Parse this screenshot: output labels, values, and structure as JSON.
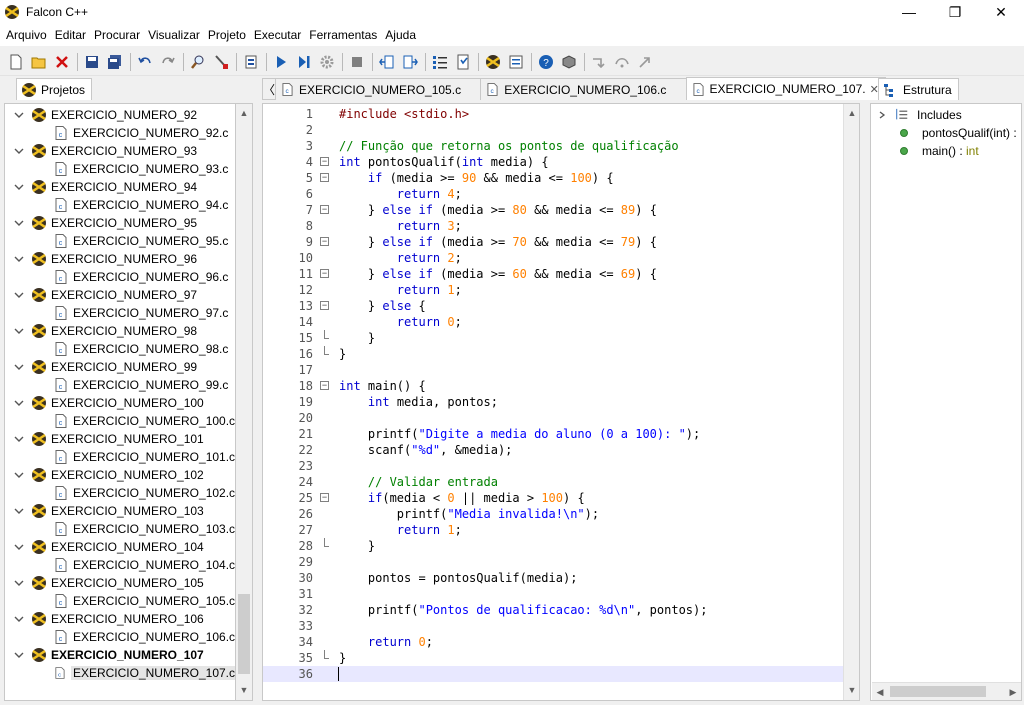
{
  "window": {
    "title": "Falcon C++",
    "minimize_label": "—",
    "maximize_label": "❐",
    "close_label": "✕"
  },
  "menu": [
    "Arquivo",
    "Editar",
    "Procurar",
    "Visualizar",
    "Projeto",
    "Executar",
    "Ferramentas",
    "Ajuda"
  ],
  "toolbar": {
    "icons": [
      "new-file-icon",
      "open-folder-icon",
      "close-file-icon",
      "save-icon",
      "save-all-icon",
      "undo-icon",
      "redo-icon",
      "find-icon",
      "replace-icon",
      "compile-icon",
      "run-icon",
      "step-icon",
      "debug-gear-icon",
      "stop-icon",
      "indent-icon",
      "unindent-icon",
      "list-icon",
      "bookmark-icon",
      "falcon-icon",
      "settings-icon",
      "help-icon",
      "packages-icon",
      "step-into-icon",
      "step-over-icon",
      "step-out-icon"
    ]
  },
  "projects_panel": {
    "tab_label": "Projetos",
    "projects": [
      {
        "name": "EXERCICIO_NUMERO_92",
        "file": "EXERCICIO_NUMERO_92.c"
      },
      {
        "name": "EXERCICIO_NUMERO_93",
        "file": "EXERCICIO_NUMERO_93.c"
      },
      {
        "name": "EXERCICIO_NUMERO_94",
        "file": "EXERCICIO_NUMERO_94.c"
      },
      {
        "name": "EXERCICIO_NUMERO_95",
        "file": "EXERCICIO_NUMERO_95.c"
      },
      {
        "name": "EXERCICIO_NUMERO_96",
        "file": "EXERCICIO_NUMERO_96.c"
      },
      {
        "name": "EXERCICIO_NUMERO_97",
        "file": "EXERCICIO_NUMERO_97.c"
      },
      {
        "name": "EXERCICIO_NUMERO_98",
        "file": "EXERCICIO_NUMERO_98.c"
      },
      {
        "name": "EXERCICIO_NUMERO_99",
        "file": "EXERCICIO_NUMERO_99.c"
      },
      {
        "name": "EXERCICIO_NUMERO_100",
        "file": "EXERCICIO_NUMERO_100.c"
      },
      {
        "name": "EXERCICIO_NUMERO_101",
        "file": "EXERCICIO_NUMERO_101.c"
      },
      {
        "name": "EXERCICIO_NUMERO_102",
        "file": "EXERCICIO_NUMERO_102.c"
      },
      {
        "name": "EXERCICIO_NUMERO_103",
        "file": "EXERCICIO_NUMERO_103.c"
      },
      {
        "name": "EXERCICIO_NUMERO_104",
        "file": "EXERCICIO_NUMERO_104.c"
      },
      {
        "name": "EXERCICIO_NUMERO_105",
        "file": "EXERCICIO_NUMERO_105.c"
      },
      {
        "name": "EXERCICIO_NUMERO_106",
        "file": "EXERCICIO_NUMERO_106.c"
      },
      {
        "name": "EXERCICIO_NUMERO_107",
        "file": "EXERCICIO_NUMERO_107.c",
        "active": true
      }
    ]
  },
  "editor": {
    "tab_nav_label": "〈",
    "tabs": [
      {
        "label": "EXERCICIO_NUMERO_105.c",
        "close": "✕",
        "active": false
      },
      {
        "label": "EXERCICIO_NUMERO_106.c",
        "close": "✕",
        "active": false
      },
      {
        "label": "EXERCICIO_NUMERO_107.",
        "close": "✕",
        "active": true
      }
    ],
    "current_line": 36,
    "lines": [
      {
        "n": "1",
        "fold": "",
        "tokens": [
          [
            "pp",
            "#include <stdio.h>"
          ]
        ]
      },
      {
        "n": "2",
        "fold": "",
        "tokens": []
      },
      {
        "n": "3",
        "fold": "",
        "tokens": [
          [
            "cmt",
            "// Função que retorna os pontos de qualificação"
          ]
        ]
      },
      {
        "n": "4",
        "fold": "open",
        "tokens": [
          [
            "kw",
            "int"
          ],
          [
            "",
            " pontosQualif("
          ],
          [
            "kw",
            "int"
          ],
          [
            "",
            " media) {"
          ]
        ]
      },
      {
        "n": "5",
        "fold": "open",
        "tokens": [
          [
            "",
            "    "
          ],
          [
            "kw",
            "if"
          ],
          [
            "",
            " (media >= "
          ],
          [
            "num",
            "90"
          ],
          [
            "",
            " && media <= "
          ],
          [
            "num",
            "100"
          ],
          [
            "",
            ") {"
          ]
        ]
      },
      {
        "n": "6",
        "fold": "",
        "tokens": [
          [
            "",
            "        "
          ],
          [
            "kw",
            "return"
          ],
          [
            "",
            " "
          ],
          [
            "num",
            "4"
          ],
          [
            "",
            ";"
          ]
        ]
      },
      {
        "n": "7",
        "fold": "open",
        "tokens": [
          [
            "",
            "    } "
          ],
          [
            "kw",
            "else if"
          ],
          [
            "",
            " (media >= "
          ],
          [
            "num",
            "80"
          ],
          [
            "",
            " && media <= "
          ],
          [
            "num",
            "89"
          ],
          [
            "",
            ") {"
          ]
        ]
      },
      {
        "n": "8",
        "fold": "",
        "tokens": [
          [
            "",
            "        "
          ],
          [
            "kw",
            "return"
          ],
          [
            "",
            " "
          ],
          [
            "num",
            "3"
          ],
          [
            "",
            ";"
          ]
        ]
      },
      {
        "n": "9",
        "fold": "open",
        "tokens": [
          [
            "",
            "    } "
          ],
          [
            "kw",
            "else if"
          ],
          [
            "",
            " (media >= "
          ],
          [
            "num",
            "70"
          ],
          [
            "",
            " && media <= "
          ],
          [
            "num",
            "79"
          ],
          [
            "",
            ") {"
          ]
        ]
      },
      {
        "n": "10",
        "fold": "",
        "tokens": [
          [
            "",
            "        "
          ],
          [
            "kw",
            "return"
          ],
          [
            "",
            " "
          ],
          [
            "num",
            "2"
          ],
          [
            "",
            ";"
          ]
        ]
      },
      {
        "n": "11",
        "fold": "open",
        "tokens": [
          [
            "",
            "    } "
          ],
          [
            "kw",
            "else if"
          ],
          [
            "",
            " (media >= "
          ],
          [
            "num",
            "60"
          ],
          [
            "",
            " && media <= "
          ],
          [
            "num",
            "69"
          ],
          [
            "",
            ") {"
          ]
        ]
      },
      {
        "n": "12",
        "fold": "",
        "tokens": [
          [
            "",
            "        "
          ],
          [
            "kw",
            "return"
          ],
          [
            "",
            " "
          ],
          [
            "num",
            "1"
          ],
          [
            "",
            ";"
          ]
        ]
      },
      {
        "n": "13",
        "fold": "open",
        "tokens": [
          [
            "",
            "    } "
          ],
          [
            "kw",
            "else"
          ],
          [
            "",
            " {"
          ]
        ]
      },
      {
        "n": "14",
        "fold": "",
        "tokens": [
          [
            "",
            "        "
          ],
          [
            "kw",
            "return"
          ],
          [
            "",
            " "
          ],
          [
            "num",
            "0"
          ],
          [
            "",
            ";"
          ]
        ]
      },
      {
        "n": "15",
        "fold": "end",
        "tokens": [
          [
            "",
            "    }"
          ]
        ]
      },
      {
        "n": "16",
        "fold": "end",
        "tokens": [
          [
            "",
            "}"
          ]
        ]
      },
      {
        "n": "17",
        "fold": "",
        "tokens": []
      },
      {
        "n": "18",
        "fold": "open",
        "tokens": [
          [
            "kw",
            "int"
          ],
          [
            "",
            " main() {"
          ]
        ]
      },
      {
        "n": "19",
        "fold": "",
        "tokens": [
          [
            "",
            "    "
          ],
          [
            "kw",
            "int"
          ],
          [
            "",
            " media, pontos;"
          ]
        ]
      },
      {
        "n": "20",
        "fold": "",
        "tokens": []
      },
      {
        "n": "21",
        "fold": "",
        "tokens": [
          [
            "",
            "    printf("
          ],
          [
            "str",
            "\"Digite a media do aluno (0 a 100): \""
          ],
          [
            "",
            ");"
          ]
        ]
      },
      {
        "n": "22",
        "fold": "",
        "tokens": [
          [
            "",
            "    scanf("
          ],
          [
            "str",
            "\"%d\""
          ],
          [
            "",
            ", &media);"
          ]
        ]
      },
      {
        "n": "23",
        "fold": "",
        "tokens": []
      },
      {
        "n": "24",
        "fold": "",
        "tokens": [
          [
            "",
            "    "
          ],
          [
            "cmt",
            "// Validar entrada"
          ]
        ]
      },
      {
        "n": "25",
        "fold": "open",
        "tokens": [
          [
            "",
            "    "
          ],
          [
            "kw",
            "if"
          ],
          [
            "",
            "(media < "
          ],
          [
            "num",
            "0"
          ],
          [
            "",
            " || media > "
          ],
          [
            "num",
            "100"
          ],
          [
            "",
            ") {"
          ]
        ]
      },
      {
        "n": "26",
        "fold": "",
        "tokens": [
          [
            "",
            "        printf("
          ],
          [
            "str",
            "\"Media invalida!\\n\""
          ],
          [
            "",
            ");"
          ]
        ]
      },
      {
        "n": "27",
        "fold": "",
        "tokens": [
          [
            "",
            "        "
          ],
          [
            "kw",
            "return"
          ],
          [
            "",
            " "
          ],
          [
            "num",
            "1"
          ],
          [
            "",
            ";"
          ]
        ]
      },
      {
        "n": "28",
        "fold": "end",
        "tokens": [
          [
            "",
            "    }"
          ]
        ]
      },
      {
        "n": "29",
        "fold": "",
        "tokens": []
      },
      {
        "n": "30",
        "fold": "",
        "tokens": [
          [
            "",
            "    pontos = pontosQualif(media);"
          ]
        ]
      },
      {
        "n": "31",
        "fold": "",
        "tokens": []
      },
      {
        "n": "32",
        "fold": "",
        "tokens": [
          [
            "",
            "    printf("
          ],
          [
            "str",
            "\"Pontos de qualificacao: %d\\n\""
          ],
          [
            "",
            ", pontos);"
          ]
        ]
      },
      {
        "n": "33",
        "fold": "",
        "tokens": []
      },
      {
        "n": "34",
        "fold": "",
        "tokens": [
          [
            "",
            "    "
          ],
          [
            "kw",
            "return"
          ],
          [
            "",
            " "
          ],
          [
            "num",
            "0"
          ],
          [
            "",
            ";"
          ]
        ]
      },
      {
        "n": "35",
        "fold": "end",
        "tokens": [
          [
            "",
            "}"
          ]
        ]
      },
      {
        "n": "36",
        "fold": "",
        "tokens": []
      }
    ]
  },
  "structure_panel": {
    "tab_label": "Estrutura",
    "includes_label": "Includes",
    "items": [
      {
        "name": "pontosQualif(int) :",
        "type": ""
      },
      {
        "name": "main() : ",
        "type": "int"
      }
    ]
  },
  "colors": {
    "keyword": "#0000d0",
    "preprocessor": "#800000",
    "number": "#ff8000",
    "string": "#0000ff",
    "comment": "#008000",
    "current_line": "#e8e8ff"
  }
}
